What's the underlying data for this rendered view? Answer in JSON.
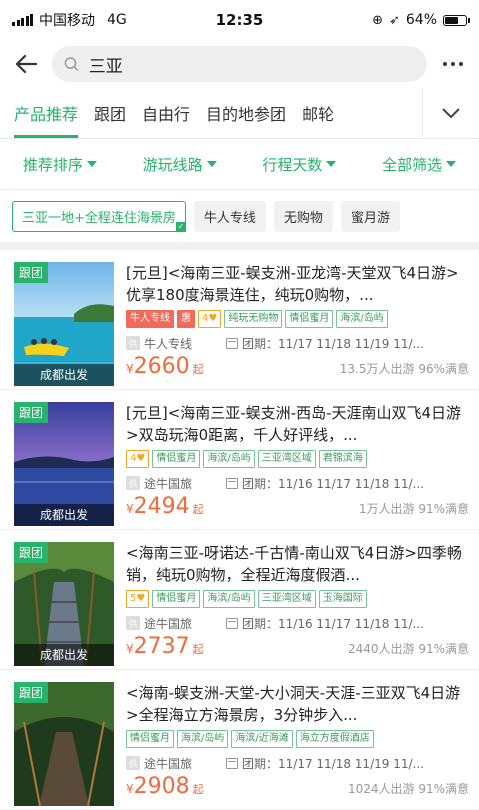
{
  "status_bar": {
    "carrier": "中国移动",
    "network": "4G",
    "time": "12:35",
    "battery_text": "64%",
    "battery_level": 0.64
  },
  "search": {
    "query": "三亚"
  },
  "tabs": [
    "产品推荐",
    "跟团",
    "自由行",
    "目的地参团",
    "邮轮"
  ],
  "filters": [
    "推荐排序",
    "游玩线路",
    "行程天数",
    "全部筛选"
  ],
  "chips": [
    "三亚一地+全程连住海景房",
    "牛人专线",
    "无购物",
    "蜜月游"
  ],
  "colors": {
    "accent": "#27b46a",
    "price": "#f26a3a"
  },
  "products": [
    {
      "type_tag": "跟团",
      "depart": "成都出发",
      "title": "[元旦]<海南三亚-蜈支洲-亚龙湾-天堂双飞4日游>优享180度海景连住，纯玩0购物，...",
      "tags": [
        {
          "text": "牛人专线",
          "style": "red"
        },
        {
          "text": "惠",
          "style": "red"
        },
        {
          "text": "4♥",
          "style": "orange"
        },
        {
          "text": "纯玩无购物",
          "style": ""
        },
        {
          "text": "情侣蜜月",
          "style": ""
        },
        {
          "text": "海滨/岛屿",
          "style": ""
        }
      ],
      "agent": "牛人专线",
      "dates": "团期：11/17 11/18 11/19 11/...",
      "yen": "¥",
      "price": "2660",
      "qi": "起",
      "stats": "13.5万人出游 96%满意"
    },
    {
      "type_tag": "跟团",
      "depart": "成都出发",
      "title": "[元旦]<海南三亚-蜈支洲-西岛-天涯南山双飞4日游>双岛玩海0距离，千人好评线，...",
      "tags": [
        {
          "text": "4♥",
          "style": "orange"
        },
        {
          "text": "情侣蜜月",
          "style": ""
        },
        {
          "text": "海滨/岛屿",
          "style": ""
        },
        {
          "text": "三亚湾区域",
          "style": ""
        },
        {
          "text": "君锦滨海",
          "style": ""
        }
      ],
      "agent": "途牛国旅",
      "dates": "团期：11/16 11/17 11/18 11/...",
      "yen": "¥",
      "price": "2494",
      "qi": "起",
      "stats": "1万人出游 91%满意"
    },
    {
      "type_tag": "跟团",
      "depart": "成都出发",
      "title": "<海南三亚-呀诺达-千古情-南山双飞4日游>四季畅销，纯玩0购物，全程近海度假酒...",
      "tags": [
        {
          "text": "5♥",
          "style": "orange"
        },
        {
          "text": "情侣蜜月",
          "style": ""
        },
        {
          "text": "海滨/岛屿",
          "style": ""
        },
        {
          "text": "三亚湾区域",
          "style": ""
        },
        {
          "text": "玉海国际",
          "style": ""
        }
      ],
      "agent": "途牛国旅",
      "dates": "团期：11/16 11/17 11/18 11/...",
      "yen": "¥",
      "price": "2737",
      "qi": "起",
      "stats": "2440人出游 91%满意"
    },
    {
      "type_tag": "跟团",
      "depart": "成都出发",
      "title": "<海南-蜈支洲-天堂-大小洞天-天涯-三亚双飞4日游>全程海立方海景房，3分钟步入...",
      "tags": [
        {
          "text": "情侣蜜月",
          "style": ""
        },
        {
          "text": "海滨/岛屿",
          "style": ""
        },
        {
          "text": "海滨/近海滩",
          "style": ""
        },
        {
          "text": "海立方度假酒店",
          "style": ""
        }
      ],
      "agent": "途牛国旅",
      "dates": "团期：11/17 11/18 11/19 11/...",
      "yen": "¥",
      "price": "2908",
      "qi": "起",
      "stats": "1024人出游 91%满意"
    }
  ]
}
